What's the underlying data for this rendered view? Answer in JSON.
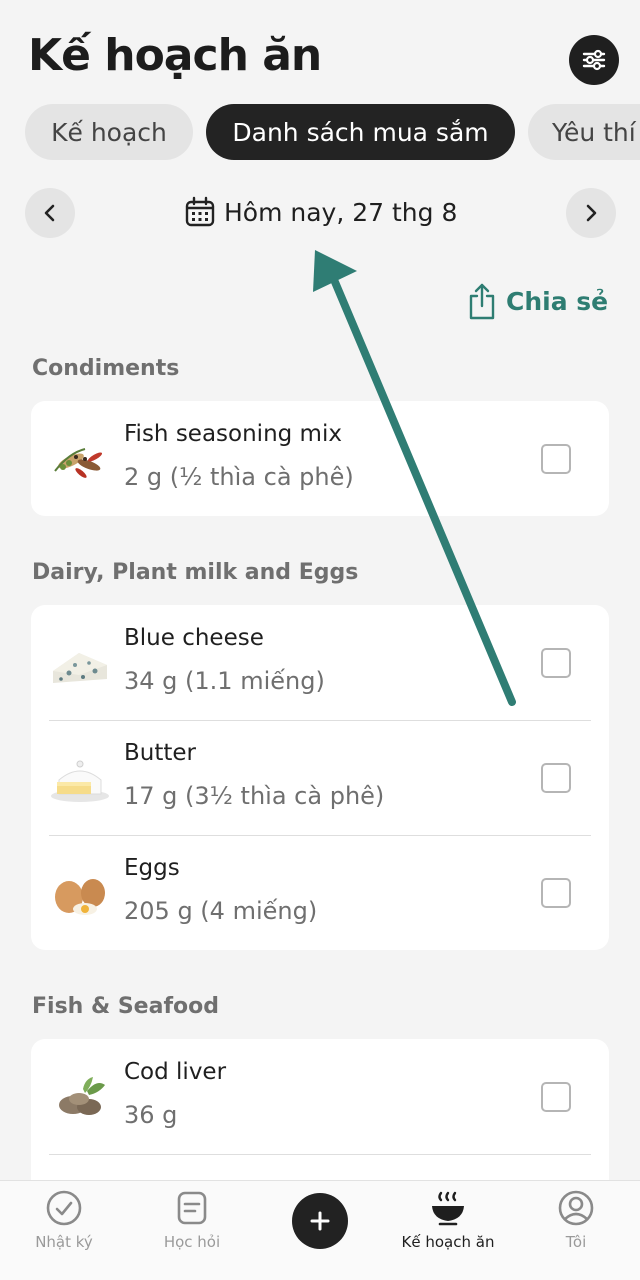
{
  "header": {
    "title": "Kế hoạch ăn"
  },
  "tabs": [
    {
      "label": "Kế hoạch",
      "active": false
    },
    {
      "label": "Danh sách mua sắm",
      "active": true
    },
    {
      "label": "Yêu thí",
      "active": false
    }
  ],
  "date_nav": {
    "label": "Hôm nay, 27 thg 8"
  },
  "share": {
    "label": "Chia sẻ"
  },
  "sections": [
    {
      "title": "Condiments",
      "items": [
        {
          "name": "Fish seasoning mix",
          "qty": "2 g (½ thìa cà phê)",
          "checked": false
        }
      ]
    },
    {
      "title": "Dairy, Plant milk and Eggs",
      "items": [
        {
          "name": "Blue cheese",
          "qty": "34 g (1.1 miếng)",
          "checked": false
        },
        {
          "name": "Butter",
          "qty": "17 g (3½ thìa cà phê)",
          "checked": false
        },
        {
          "name": "Eggs",
          "qty": "205 g (4 miếng)",
          "checked": false
        }
      ]
    },
    {
      "title": "Fish & Seafood",
      "items": [
        {
          "name": "Cod liver",
          "qty": "36 g",
          "checked": false
        }
      ]
    }
  ],
  "bottom_nav": [
    {
      "label": "Nhật ký",
      "icon": "check-circle-icon",
      "active": false
    },
    {
      "label": "Học hỏi",
      "icon": "note-icon",
      "active": false
    },
    {
      "label": "",
      "icon": "plus-icon",
      "active": false
    },
    {
      "label": "Kế hoạch ăn",
      "icon": "bowl-icon",
      "active": true
    },
    {
      "label": "Tôi",
      "icon": "user-icon",
      "active": false
    }
  ],
  "colors": {
    "accent": "#2e7d72",
    "dark": "#232323",
    "background": "#f4f4f4"
  }
}
